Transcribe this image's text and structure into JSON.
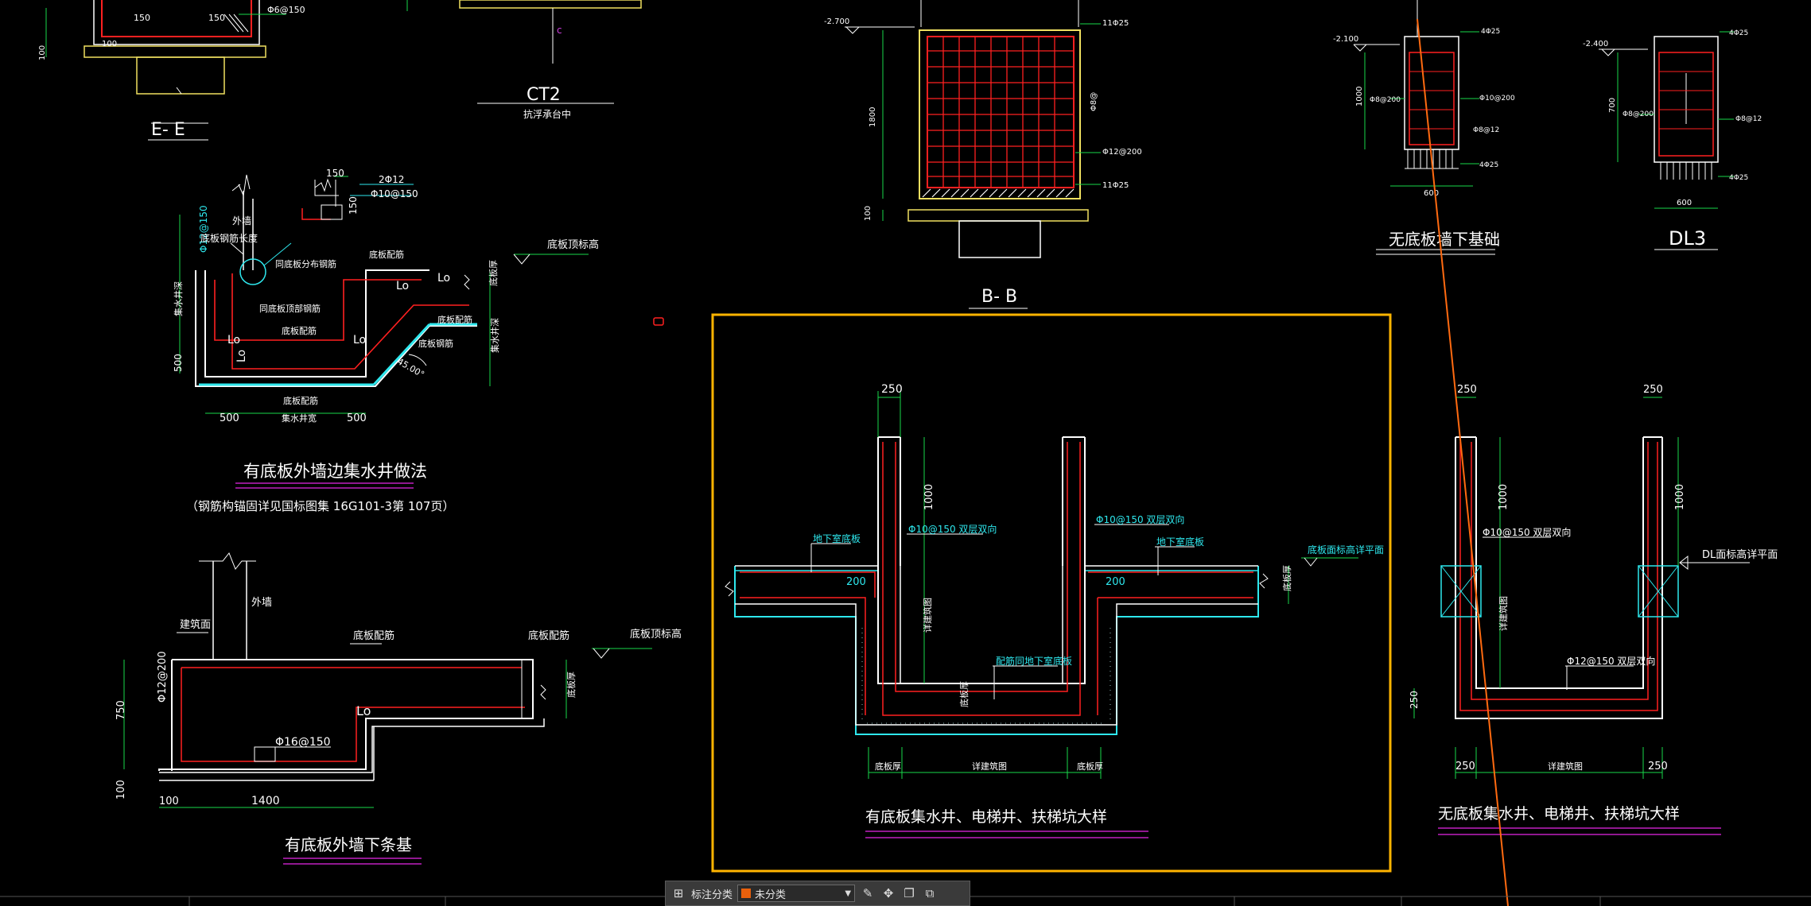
{
  "colors": {
    "bg": "#000000",
    "wall": "#ffffff",
    "rebar": "#ff2020",
    "dim": "#18d84a",
    "annot": "#2ee8ee",
    "title": "#ffffff",
    "highlight": "#ffb400",
    "underline_magenta": "#c020c0",
    "leader": "#ff6a10"
  },
  "labels": {
    "ee_title": "E- E",
    "ee_dim_150a": "150",
    "ee_dim_150b": "150",
    "ee_note": "Φ6@150",
    "ee_dim_100a": "100",
    "ee_dim_100b": "100",
    "ct2_title": "CT2",
    "ct2_sub": "抗浮承台中",
    "bb_title": "B- B",
    "bb_elev": "-2.700",
    "bb_dim_h": "1800",
    "bb_dim_100": "100",
    "bb_r1": "11Φ25",
    "bb_r2": "Φ12@200",
    "bb_r3": "11Φ25",
    "bb_r4": "Φ8@",
    "wdb_title": "无底板墙下基础",
    "wdb_elev": "-2.100",
    "wdb_dim_h": "1000",
    "wdb_dim_600": "600",
    "wdb_r1": "4Φ25",
    "wdb_r2": "Φ8@200",
    "wdb_r3": "Φ10@200",
    "wdb_r4": "Φ8@12",
    "wdb_r5": "4Φ25",
    "dl3_title": "DL3",
    "dl3_elev": "-2.400",
    "dl3_dim_h": "700",
    "dl3_dim_600": "600",
    "dl3_r1": "4Φ25",
    "dl3_r2": "Φ8@200",
    "dl3_r3": "Φ8@12",
    "dl3_r4": "4Φ25",
    "ws_title": "有底板外墙边集水井做法",
    "ws_sub": "（钢筋构锚固详见国标图集 16G101-3第 107页）",
    "ws_150": "150",
    "ws_2c12": "2Φ12",
    "ws_c10": "Φ10@150",
    "ws_c12": "Φ12@150",
    "ws_wall": "外墙",
    "ws_outside": "底板钢筋长度",
    "ws_top": "底板顶标高",
    "ws_bottom_rebar": "底板钢筋",
    "ws_lo1": "Lo",
    "ws_lo2": "Lo",
    "ws_lo3": "Lo",
    "ws_lo4": "Lo",
    "ws_lo5": "Lo",
    "ws_500a": "500",
    "ws_500b": "500",
    "ws_500c": "500",
    "ws_well": "集水井宽",
    "ws_r1": "同底板分布钢筋",
    "ws_r2": "同底板顶部钢筋",
    "ws_r3": "底板配筋",
    "ws_r4": "底板配筋",
    "ws_r5": "底板配筋",
    "ws_h": "底板厚",
    "ws_depth": "集水井深",
    "ws_deep": "集水井深",
    "ws_angle": "45.00°",
    "strip_title": "有底板外墙下条基",
    "strip_wall": "外墙",
    "strip_level": "建筑面",
    "strip_rebar1": "底板配筋",
    "strip_rebar2": "底板配筋",
    "strip_top": "底板顶标高",
    "strip_c12": "Φ12@200",
    "strip_c16": "Φ16@150",
    "strip_750": "750",
    "strip_100a": "100",
    "strip_100b": "100",
    "strip_1400": "1400",
    "strip_lo": "Lo",
    "strip_h": "底板厚",
    "main_title": "有底板集水井、电梯井、扶梯坑大样",
    "main_250": "250",
    "main_1000": "1000",
    "main_200a": "200",
    "main_200b": "200",
    "main_r1": "Φ10@150 双层双向",
    "main_r2": "Φ10@150 双层双向",
    "main_basement1": "地下室底板",
    "main_basement2": "地下室底板",
    "main_top": "底板面标高详平面",
    "main_bottom": "配筋同地下室底板",
    "main_thk": "底板厚",
    "main_depth": "详建筑图",
    "main_pitw": "详建筑图",
    "main_side1": "底板厚",
    "main_side2": "底板厚",
    "main_h": "底板厚",
    "nb_title": "无底板集水井、电梯井、扶梯坑大样",
    "nb_250a": "250",
    "nb_250b": "250",
    "nb_250c": "250",
    "nb_250d": "250",
    "nb_250e": "250",
    "nb_1000a": "1000",
    "nb_1000b": "1000",
    "nb_r1": "Φ10@150 双层双向",
    "nb_r2": "Φ12@150 双层双向",
    "nb_dl": "DL面标高详平面",
    "nb_depth": "详建筑图",
    "nb_pitw": "详建筑图"
  },
  "toolbar": {
    "grid_icon": "grid-icon",
    "label": "标注分类",
    "select_value": "未分类",
    "select_color": "#e8600c",
    "tools": [
      "edit-icon",
      "move-icon",
      "copy-icon",
      "paste-icon"
    ]
  }
}
